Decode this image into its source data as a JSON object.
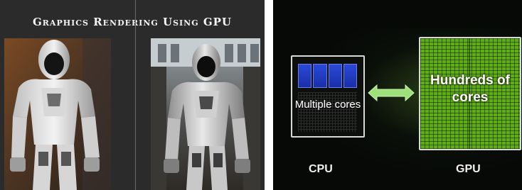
{
  "left": {
    "title": "Graphics Rendering Using GPU",
    "images": [
      "armored-figure-render-plain",
      "armored-figure-render-gpu"
    ]
  },
  "right": {
    "cpu": {
      "inner_label": "Multiple cores",
      "caption": "CPU",
      "core_count_shown": 4
    },
    "gpu": {
      "inner_label": "Hundreds of cores",
      "caption": "GPU"
    },
    "arrow_icon": "double-arrow-icon",
    "colors": {
      "gpu_green": "#5fae16",
      "cpu_blue": "#2a49d8",
      "arrow_green": "#9ee07a"
    }
  }
}
